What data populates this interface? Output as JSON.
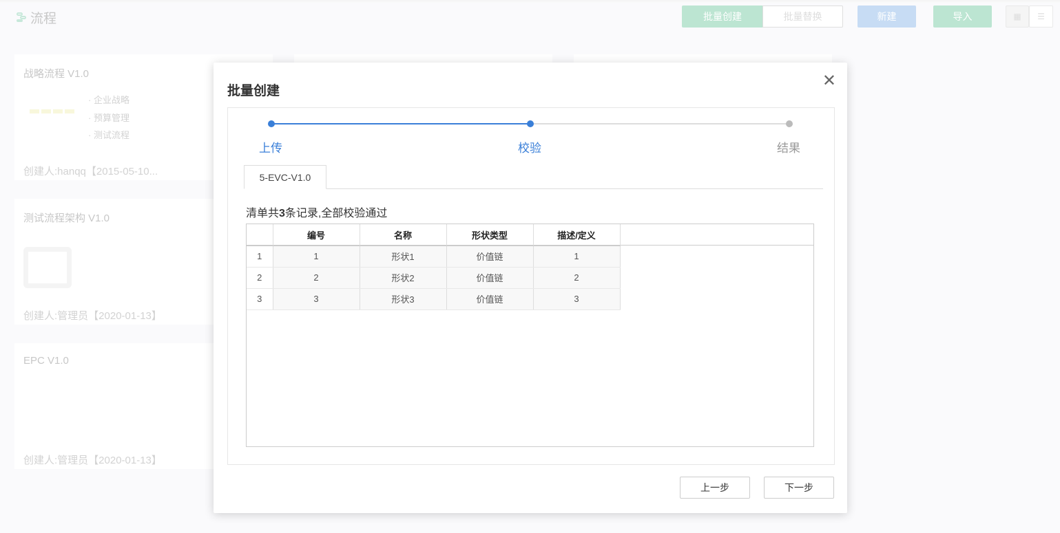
{
  "page": {
    "title": "流程"
  },
  "toolbar": {
    "batch_create": "批量创建",
    "batch_replace": "批量替换",
    "new": "新建",
    "import": "导入"
  },
  "colors": {
    "green": "#98d8bb",
    "blue": "#a9c9ee",
    "accent": "#3a7fd8"
  },
  "cards": [
    {
      "title": "战略流程 V1.0",
      "items": [
        "企业战略",
        "预算管理",
        "测试流程"
      ],
      "creator": "创建人:hanqq【2015-05-10..."
    },
    {
      "title": "测试流程架构 V1.0",
      "creator": "创建人:管理员【2020-01-13】"
    },
    {
      "title": "EPC V1.0",
      "creator": "创建人:管理员【2020-01-13】"
    }
  ],
  "modal": {
    "title": "批量创建",
    "steps": [
      {
        "label": "上传",
        "state": "done"
      },
      {
        "label": "校验",
        "state": "active"
      },
      {
        "label": "结果",
        "state": "pending"
      }
    ],
    "tab": "5-EVC-V1.0",
    "summary": {
      "prefix": "清单共",
      "count": "3",
      "suffix": "条记录,全部校验通过"
    },
    "table": {
      "headers": [
        "",
        "编号",
        "名称",
        "形状类型",
        "描述/定义"
      ],
      "rows": [
        [
          "1",
          "1",
          "形状1",
          "价值链",
          "1"
        ],
        [
          "2",
          "2",
          "形状2",
          "价值链",
          "2"
        ],
        [
          "3",
          "3",
          "形状3",
          "价值链",
          "3"
        ]
      ]
    },
    "prev": "上一步",
    "next": "下一步"
  }
}
